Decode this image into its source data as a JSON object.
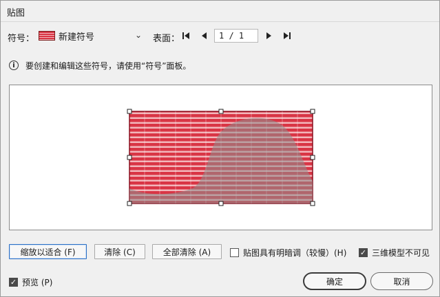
{
  "window": {
    "title": "贴图"
  },
  "symbol_row": {
    "symbol_label": "符号：",
    "symbol_value": "新建符号",
    "surface_label": "表面：",
    "page_value": "1 / 1"
  },
  "info": {
    "text": "要创建和编辑这些符号，请使用“符号”面板。"
  },
  "buttons": {
    "fit": "缩放以适合 (F)",
    "clear": "清除 (C)",
    "clear_all": "全部清除 (A)",
    "ok": "确定",
    "cancel": "取消"
  },
  "checkboxes": {
    "shade_art": {
      "label": "贴图具有明暗调（较慢）(H)",
      "checked": false
    },
    "invisible_geometry": {
      "label": "三维模型不可见",
      "checked": true
    },
    "preview": {
      "label": "预览 (P)",
      "checked": true
    }
  },
  "colors": {
    "symbol_red": "#d93545",
    "symbol_light": "#f2b6bb",
    "model_gray": "#8e8e8e"
  }
}
